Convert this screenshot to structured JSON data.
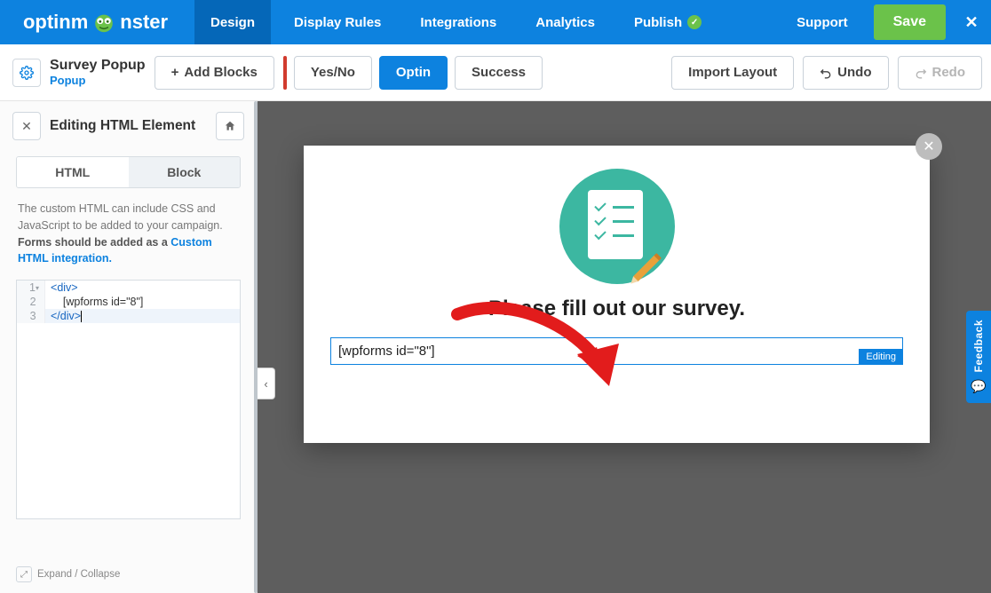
{
  "brand": {
    "name_a": "optinm",
    "name_b": "nster"
  },
  "nav": {
    "design": "Design",
    "display_rules": "Display Rules",
    "integrations": "Integrations",
    "analytics": "Analytics",
    "publish": "Publish",
    "support": "Support",
    "save": "Save",
    "close": "✕"
  },
  "campaign": {
    "title": "Survey Popup",
    "type": "Popup"
  },
  "toolbar": {
    "add_blocks": "Add Blocks",
    "yes_no": "Yes/No",
    "optin": "Optin",
    "success": "Success",
    "import_layout": "Import Layout",
    "undo": "Undo",
    "redo": "Redo"
  },
  "sidebar": {
    "title": "Editing HTML Element",
    "tabs": {
      "html": "HTML",
      "block": "Block"
    },
    "help_a": "The custom HTML can include CSS and JavaScript to be added to your campaign. ",
    "help_b": "Forms should be added as a ",
    "help_link": "Custom HTML integration.",
    "code": {
      "l1_open": "div",
      "l2_text": "[wpforms id=\"8\"]",
      "l3_close": "div"
    },
    "expand": "Expand / Collapse"
  },
  "canvas": {
    "heading": "Please fill out our survey.",
    "html_block_text": "[wpforms id=\"8\"]",
    "editing_badge": "Editing"
  },
  "feedback": {
    "label": "Feedback"
  }
}
